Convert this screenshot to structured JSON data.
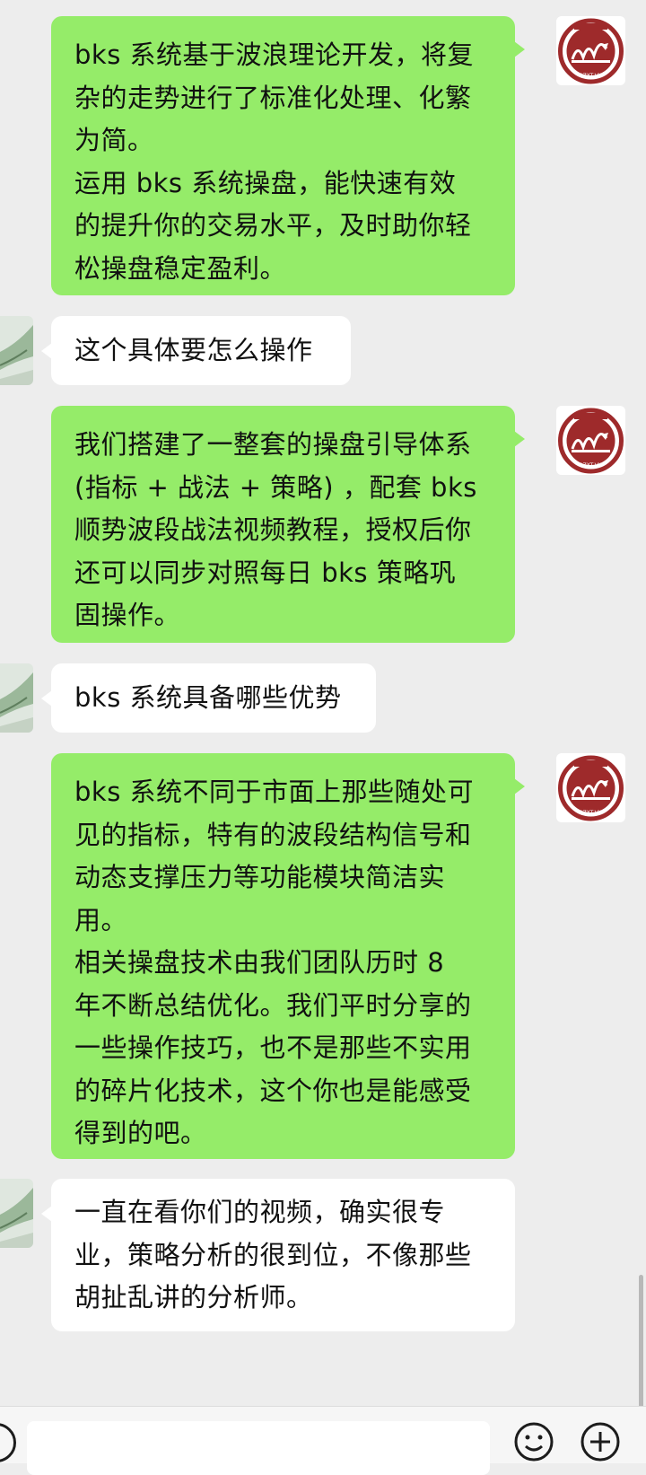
{
  "conversation": {
    "messages": [
      {
        "side": "out",
        "lines": [
          "bks 系统基于波浪理论开发，将复",
          "杂的走势进行了标准化处理、化繁",
          "为简。",
          "运用 bks 系统操盘，能快速有效",
          "的提升你的交易水平，及时助你轻",
          "松操盘稳定盈利。"
        ]
      },
      {
        "side": "in",
        "lines": [
          "这个具体要怎么操作"
        ]
      },
      {
        "side": "out",
        "lines": [
          "我们搭建了一整套的操盘引导体系",
          "(指标 + 战法 + 策略) ，配套 bks",
          "顺势波段战法视频教程，授权后你",
          "还可以同步对照每日 bks 策略巩",
          "固操作。"
        ]
      },
      {
        "side": "in",
        "lines": [
          "bks 系统具备哪些优势"
        ]
      },
      {
        "side": "out",
        "lines": [
          "bks 系统不同于市面上那些随处可",
          "见的指标，特有的波段结构信号和",
          "动态支撑压力等功能模块简洁实",
          "用。",
          "相关操盘技术由我们团队历时 8",
          "年不断总结优化。我们平时分享的",
          "一些操作技巧，也不是那些不实用",
          "的碎片化技术，这个你也是能感受",
          "得到的吧。"
        ]
      },
      {
        "side": "in",
        "lines": [
          "一直在看你们的视频，确实很专",
          "业，策略分析的很到位，不像那些",
          "胡扯乱讲的分析师。"
        ]
      }
    ]
  },
  "avatar": {
    "logo_text": "QZXT.VIP",
    "logo_color": "#9e2a2b"
  },
  "input_bar": {
    "value": "",
    "voice_icon": "voice-icon",
    "emoji_icon": "emoji-icon",
    "plus_icon": "plus-icon"
  },
  "colors": {
    "outgoing_bubble": "#95ec69",
    "incoming_bubble": "#ffffff",
    "background": "#ededed"
  }
}
